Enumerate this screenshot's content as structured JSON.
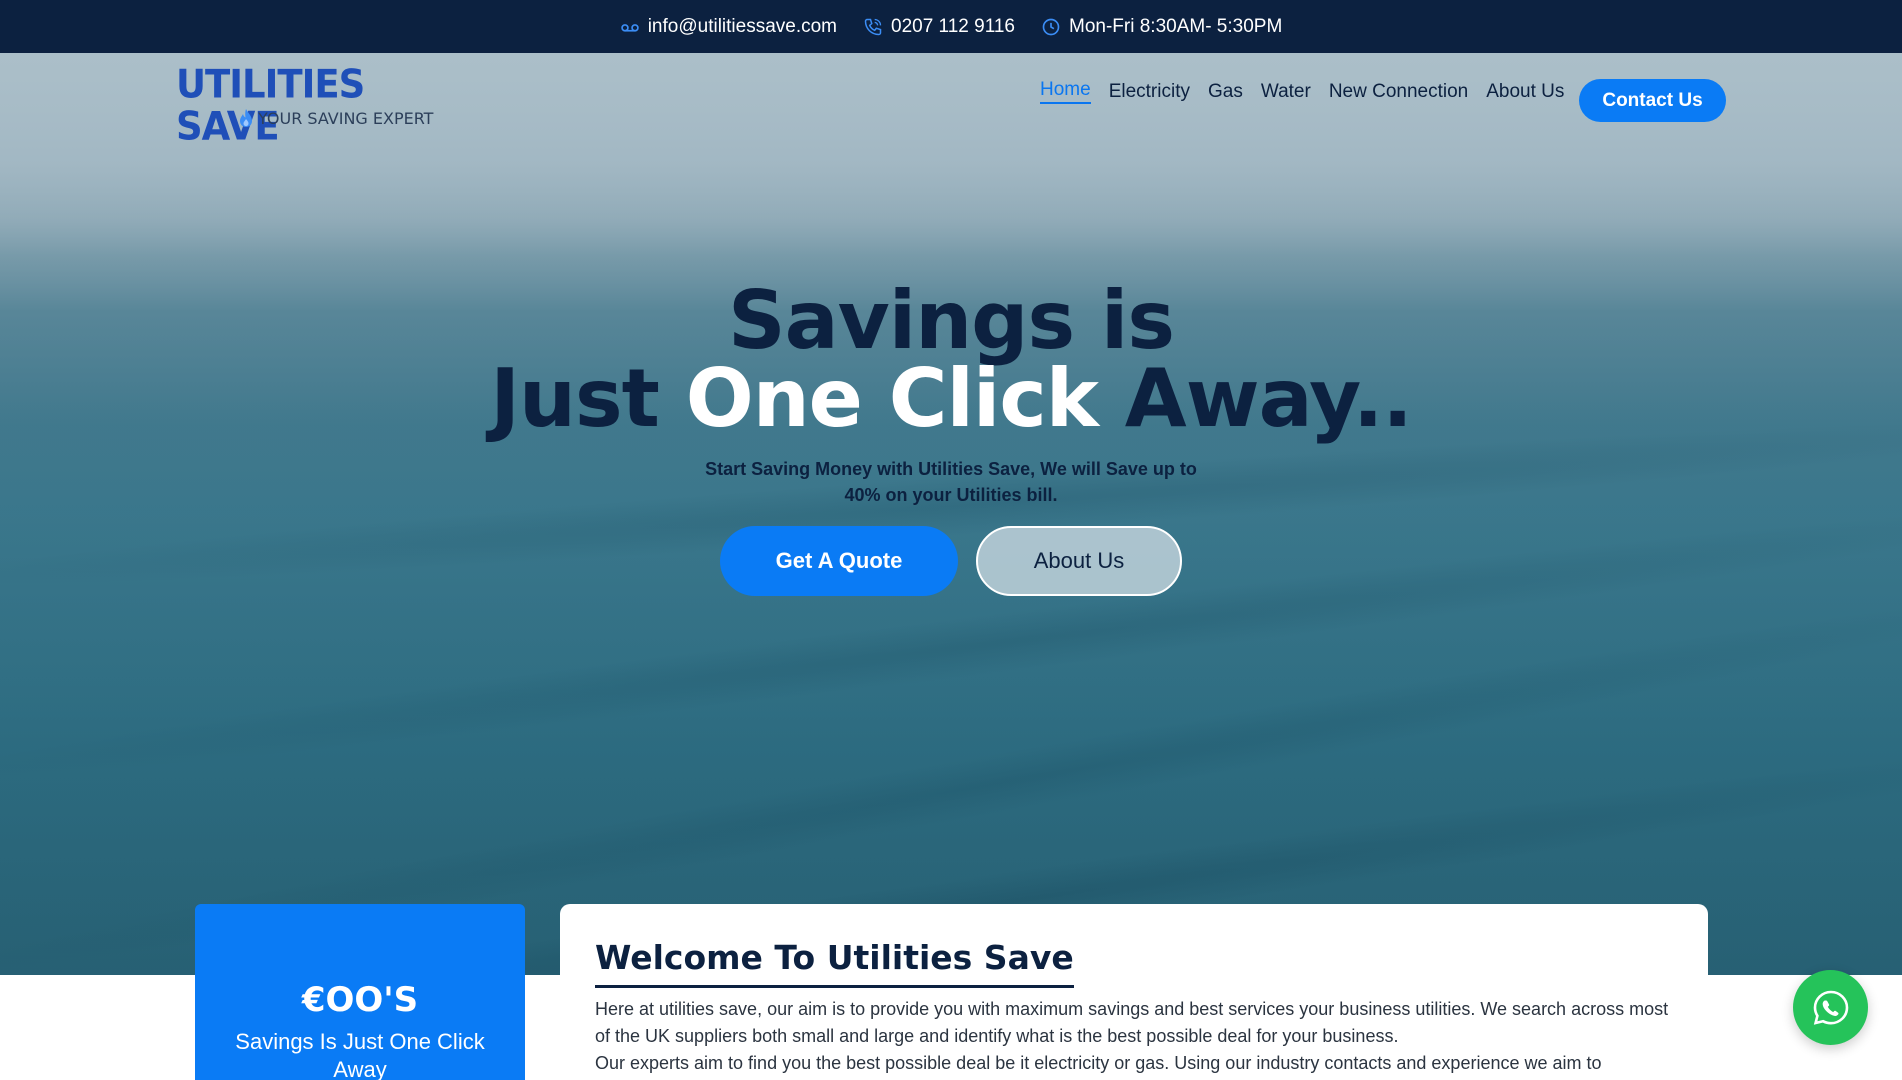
{
  "topbar": {
    "email": "info@utilitiessave.com",
    "email_icon": "voicemail-icon",
    "phone": "0207 112 9116",
    "phone_icon": "phone-icon",
    "hours": "Mon-Fri 8:30AM- 5:30PM",
    "hours_icon": "clock-icon"
  },
  "logo": {
    "name": "UTILITIES SAVE",
    "tagline": "YOUR SAVING EXPERT"
  },
  "nav": {
    "items": [
      {
        "label": "Home",
        "active": true
      },
      {
        "label": "Electricity"
      },
      {
        "label": "Gas"
      },
      {
        "label": "Water"
      },
      {
        "label": "New Connection"
      },
      {
        "label": "About Us"
      }
    ],
    "cta": "Contact Us"
  },
  "hero": {
    "line1": "Savings is",
    "line2_part1": "Just ",
    "line2_part2": "One Click",
    "line2_part3": " Away..",
    "subtitle_line1": "Start Saving Money with Utilities Save, We will Save up to",
    "subtitle_line2": "40% on your Utilities bill.",
    "primary_button": "Get A Quote",
    "secondary_button": "About Us"
  },
  "savings_card": {
    "amount": "€OO'S",
    "text": "Savings Is Just One Click Away"
  },
  "welcome": {
    "title": "Welcome To Utilities Save",
    "paragraph1": "Here at utilities save, our aim is to provide you with maximum savings and best services your business utilities. We search across most of the UK suppliers both small and large and identify what is the best possible deal for your business.",
    "paragraph2": "Our experts aim to find you the best possible deal be it electricity or gas. Using our industry contacts and experience we aim to"
  },
  "colors": {
    "navy": "#0c2140",
    "accent_blue": "#0a7bf5",
    "whatsapp_green": "#25c35a"
  }
}
